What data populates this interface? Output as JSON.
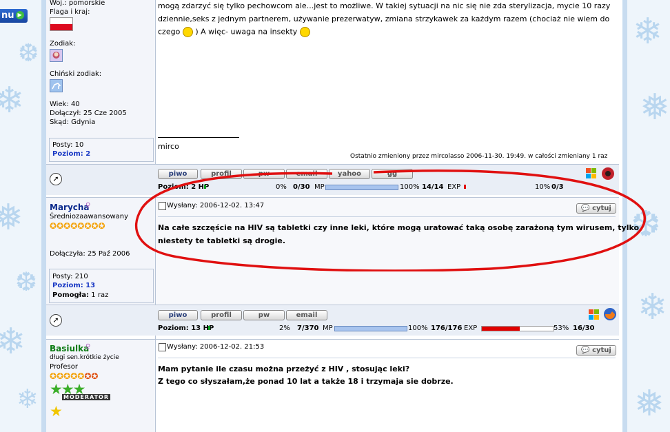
{
  "nav": {
    "menu_label": "nu"
  },
  "post1": {
    "author_info": {
      "woj": "Woj.: pomorskie",
      "flag_label": "Flaga i kraj:",
      "zodiac_label": "Zodiak:",
      "chinese_zodiac_label": "Chiński zodiak:",
      "age": "Wiek: 40",
      "joined": "Dołączył: 25 Cze 2005",
      "location": "Skąd: Gdynia",
      "posts": "Posty: 10",
      "level": "Poziom: 2"
    },
    "body_line1": "mogą zdarzyć się tylko pechowcom ale...jest to możliwe. W takiej sytuacji na nic się nie zda sterylizacja, mycie 10 razy",
    "body_line2": "dziennie,seks z jednym partnerem, używanie prezerwatyw, zmiana strzykawek za każdym razem (chociaż nie wiem do",
    "body_line3a": "czego",
    "body_line3b": ") A więc- uwaga na insekty",
    "signature": "mirco",
    "edited_note": "Ostatnio zmieniony przez mircolasso 2006-11-30. 19:49. w całości zmieniany 1 raz",
    "buttons": [
      "piwo",
      "profil",
      "pw",
      "email",
      "yahoo",
      "gg"
    ],
    "stats": {
      "level": "Poziom: 2 HP",
      "hp_pct": "0%",
      "hp_val": "0/30",
      "mp_label": "MP",
      "mp_pct": "100%",
      "mp_val": "14/14",
      "exp_label": "EXP",
      "exp_pct": "10%",
      "exp_val": "0/3",
      "mp_fill": 1.0
    }
  },
  "post2": {
    "author": "Marycha",
    "rank": "Średniozaawansowany",
    "joined": "Dołączyła: 25 Paź 2006",
    "posts": "Posty: 210",
    "level": "Poziom: 13",
    "helped": "Pomogła: 1 raz",
    "posted": "Wysłany: 2006-12-02. 13:47",
    "quote_label": "cytuj",
    "body_line1": "Na całe szczęście na HIV są tabletki czy inne leki, które mogą uratować taką osobę zarażoną tym wirusem, tylko",
    "body_line2": "niestety te tabletki są drogie.",
    "buttons": [
      "piwo",
      "profil",
      "pw",
      "email"
    ],
    "stats": {
      "level": "Poziom: 13 HP",
      "hp_pct": "2%",
      "hp_val": "7/370",
      "mp_label": "MP",
      "mp_pct": "100%",
      "mp_val": "176/176",
      "exp_label": "EXP",
      "exp_pct": "53%",
      "exp_val": "16/30",
      "mp_fill": 1.0,
      "exp_fill": 0.53
    }
  },
  "post3": {
    "author": "Basiulka",
    "rank": "długi sen.krótkie życie",
    "title": "Profesor",
    "badge": "MODERATOR",
    "posted": "Wysłany: 2006-12-02. 21:53",
    "quote_label": "cytuj",
    "body_line1": "Mam pytanie ile czasu można przeżyć z HIV , stosując leki?",
    "body_line2": "Z tego co słyszałam,że ponad 10 lat a także 18 i trzymaja sie dobrze."
  },
  "colors": {
    "annotation": "#e01010",
    "author_blue": "#0b2a8c",
    "author_green": "#0a7a12",
    "exp_bar": "#e00000",
    "mp_bar": "#a8c4ee"
  }
}
